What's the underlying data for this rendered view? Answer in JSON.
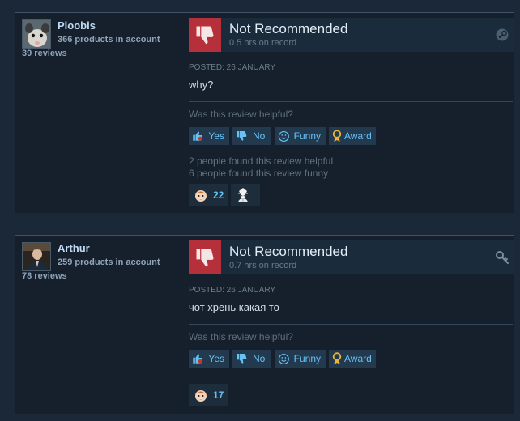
{
  "reviews": [
    {
      "user": {
        "name": "Ploobis",
        "products": "366 products in account",
        "reviews": "39 reviews",
        "avatar_icon": "possum-avatar"
      },
      "verdict": "Not Recommended",
      "hours": "0.5 hrs on record",
      "platform_icon": "steam-icon",
      "posted": "POSTED: 26 JANUARY",
      "text": "why?",
      "helpful_question": "Was this review helpful?",
      "buttons": {
        "yes": "Yes",
        "no": "No",
        "funny": "Funny",
        "award": "Award"
      },
      "found_helpful": "2 people found this review helpful",
      "found_funny": "6 people found this review funny",
      "reactions": [
        {
          "icon": "baby-face-icon",
          "count": "22"
        },
        {
          "icon": "detective-icon",
          "count": ""
        }
      ]
    },
    {
      "user": {
        "name": "Arthur",
        "products": "259 products in account",
        "reviews": "78 reviews",
        "avatar_icon": "man-in-suit-avatar"
      },
      "verdict": "Not Recommended",
      "hours": "0.7 hrs on record",
      "platform_icon": "key-icon",
      "posted": "POSTED: 26 JANUARY",
      "text": "чот хрень какая то",
      "helpful_question": "Was this review helpful?",
      "buttons": {
        "yes": "Yes",
        "no": "No",
        "funny": "Funny",
        "award": "Award"
      },
      "reactions": [
        {
          "icon": "baby-face-icon",
          "count": "17"
        }
      ]
    }
  ],
  "colors": {
    "thumb_down_bg": "#b5303a",
    "link_blue": "#67c1f5",
    "award_gold": "#e6b53a"
  }
}
